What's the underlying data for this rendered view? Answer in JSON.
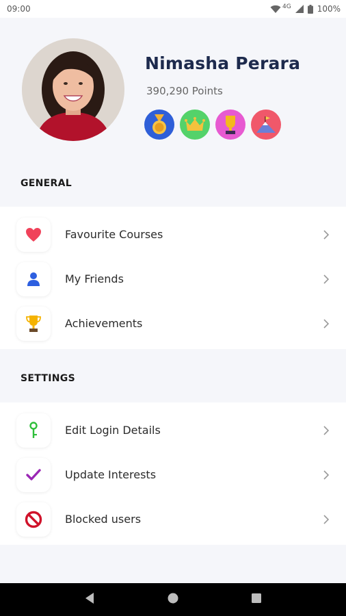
{
  "status_bar": {
    "time": "09:00",
    "network": "4G",
    "battery": "100%"
  },
  "profile": {
    "name": "Nimasha Perara",
    "points": "390,290 Points",
    "badges": [
      {
        "icon": "medal-icon",
        "color": "#2f5fd8"
      },
      {
        "icon": "crown-icon",
        "color": "#54d26a"
      },
      {
        "icon": "trophy-icon",
        "color": "#e75ad1"
      },
      {
        "icon": "mountain-flag-icon",
        "color": "#f0586a"
      }
    ]
  },
  "general": {
    "title": "GENERAL",
    "items": [
      {
        "label": "Favourite Courses",
        "icon": "heart-icon",
        "color": "#f0425a"
      },
      {
        "label": "My Friends",
        "icon": "person-icon",
        "color": "#2d5fe0"
      },
      {
        "label": "Achievements",
        "icon": "trophy-icon",
        "color": "#f5b301"
      }
    ]
  },
  "settings": {
    "title": "SETTINGS",
    "items": [
      {
        "label": "Edit Login Details",
        "icon": "key-icon",
        "color": "#2fbf3a"
      },
      {
        "label": "Update Interests",
        "icon": "checkmark-icon",
        "color": "#9b27b5"
      },
      {
        "label": "Blocked users",
        "icon": "block-icon",
        "color": "#d0122a"
      }
    ]
  },
  "colors": {
    "background": "#f5f6fa",
    "card": "#ffffff",
    "name": "#1d2a4d"
  }
}
